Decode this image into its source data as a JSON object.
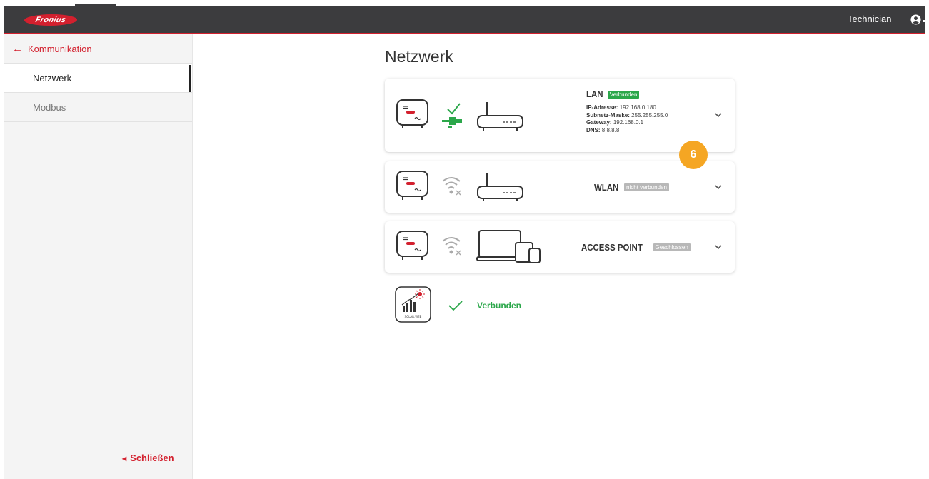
{
  "header": {
    "brand": "Fronius",
    "user_label": "Technician"
  },
  "sidebar": {
    "back_label": "Kommunikation",
    "items": [
      {
        "label": "Netzwerk",
        "active": true
      },
      {
        "label": "Modbus",
        "active": false
      }
    ],
    "close_label": "Schließen"
  },
  "main": {
    "title": "Netzwerk",
    "cards": [
      {
        "name": "LAN",
        "status": "Verbunden",
        "details": [
          {
            "key": "IP-Adresse:",
            "value": "192.168.0.180"
          },
          {
            "key": "Subnetz-Maske:",
            "value": "255.255.255.0"
          },
          {
            "key": "Gateway:",
            "value": "192.168.0.1"
          },
          {
            "key": "DNS:",
            "value": "8.8.8.8"
          }
        ]
      },
      {
        "name": "WLAN",
        "status": "nicht verbunden"
      },
      {
        "name": "ACCESS POINT",
        "status": "Geschlossen"
      }
    ],
    "step_marker": "6",
    "solar_web": {
      "icon_caption": "SOLAR.WEB",
      "status": "Verbunden"
    }
  },
  "icons": {
    "back": "arrow-left-icon",
    "user": "user-circle-icon",
    "expand": "chevron-down-icon",
    "close": "chevron-left-icon"
  },
  "colors": {
    "brand_red": "#d3202e",
    "header_bg": "#3c3c3e",
    "connected_green": "#2ba74a",
    "inactive_gray": "#b8b8b8",
    "marker_orange": "#f5a623"
  }
}
